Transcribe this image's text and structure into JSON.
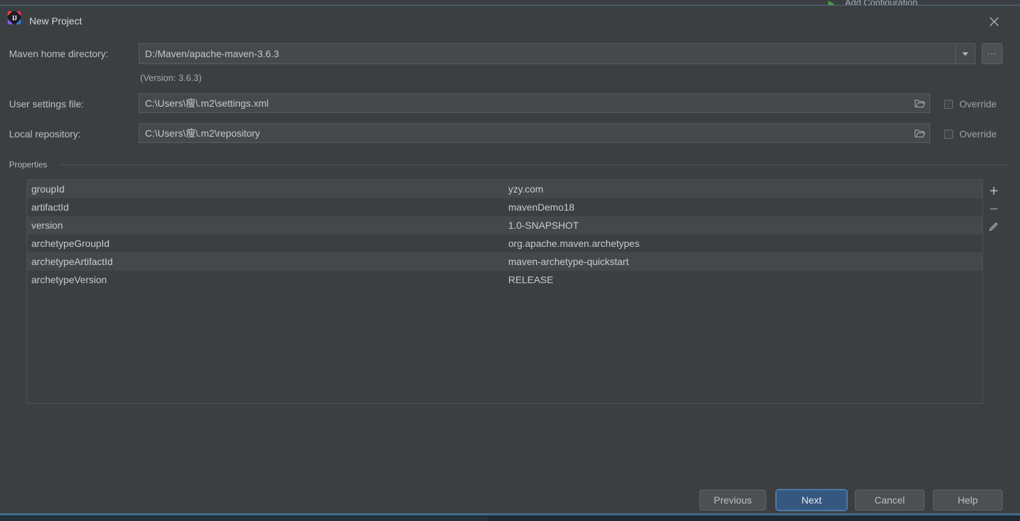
{
  "background": {
    "add_configuration_label": "Add Configuration...",
    "run_icon": "run-triangle-icon"
  },
  "dialog": {
    "title": "New Project",
    "app_icon": "intellij-idea-icon",
    "close_icon": "close-icon"
  },
  "form": {
    "maven_home": {
      "label": "Maven home directory:",
      "value": "D:/Maven/apache-maven-3.6.3",
      "dropdown_icon": "chevron-down-icon",
      "browse_label": "...",
      "version_note": "(Version: 3.6.3)"
    },
    "user_settings": {
      "label": "User settings file:",
      "value": "C:\\Users\\瘦\\.m2\\settings.xml",
      "folder_icon": "folder-icon",
      "override_label": "Override",
      "override_checked": false
    },
    "local_repository": {
      "label": "Local repository:",
      "value": "C:\\Users\\瘦\\.m2\\repository",
      "folder_icon": "folder-icon",
      "override_label": "Override",
      "override_checked": false
    }
  },
  "properties": {
    "section_label": "Properties",
    "rows": [
      {
        "key": "groupId",
        "value": "yzy.com"
      },
      {
        "key": "artifactId",
        "value": "mavenDemo18"
      },
      {
        "key": "version",
        "value": "1.0-SNAPSHOT"
      },
      {
        "key": "archetypeGroupId",
        "value": "org.apache.maven.archetypes"
      },
      {
        "key": "archetypeArtifactId",
        "value": "maven-archetype-quickstart"
      },
      {
        "key": "archetypeVersion",
        "value": "RELEASE"
      }
    ],
    "toolbar": {
      "add_icon": "plus-icon",
      "remove_icon": "minus-icon",
      "edit_icon": "pencil-icon"
    }
  },
  "footer": {
    "previous_label": "Previous",
    "next_label": "Next",
    "cancel_label": "Cancel",
    "help_label": "Help"
  },
  "colors": {
    "dialog_bg": "#3c3f41",
    "field_bg": "#45494a",
    "row_alt_bg": "#44484a",
    "primary_button": "#365880",
    "accent_border": "#4a6f8a"
  }
}
